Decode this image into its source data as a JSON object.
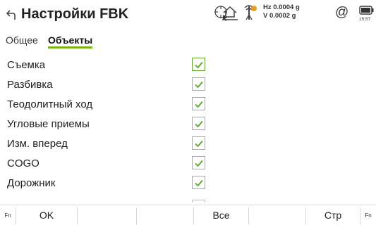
{
  "titlebar": {
    "title": "Настройки FBK",
    "status": {
      "hz_line": "Hz 0.0004 g",
      "v_line": "V  0.0002 g",
      "at_symbol": "@",
      "clock": "15:57"
    },
    "icons": [
      "back-arrow-icon",
      "crosshair-target-icon",
      "home-level-icon",
      "antenna-signal-icon",
      "battery-icon"
    ]
  },
  "tabs": [
    {
      "label": "Общее",
      "active": false
    },
    {
      "label": "Объекты",
      "active": true
    }
  ],
  "accent_color": "#7cb518",
  "rows": [
    {
      "label": "Съемка",
      "checked": true,
      "focused": true
    },
    {
      "label": "Разбивка",
      "checked": true,
      "focused": false
    },
    {
      "label": "Теодолитный ход",
      "checked": true,
      "focused": false
    },
    {
      "label": "Угловые приемы",
      "checked": true,
      "focused": false
    },
    {
      "label": "Изм. вперед",
      "checked": true,
      "focused": false
    },
    {
      "label": "COGO",
      "checked": true,
      "focused": false
    },
    {
      "label": "Дорожник",
      "checked": true,
      "focused": false
    }
  ],
  "fnbar": {
    "fn_left": "Fn",
    "f1": "OK",
    "f4": "Все",
    "f6": "Стр",
    "fn_right": "Fn"
  }
}
